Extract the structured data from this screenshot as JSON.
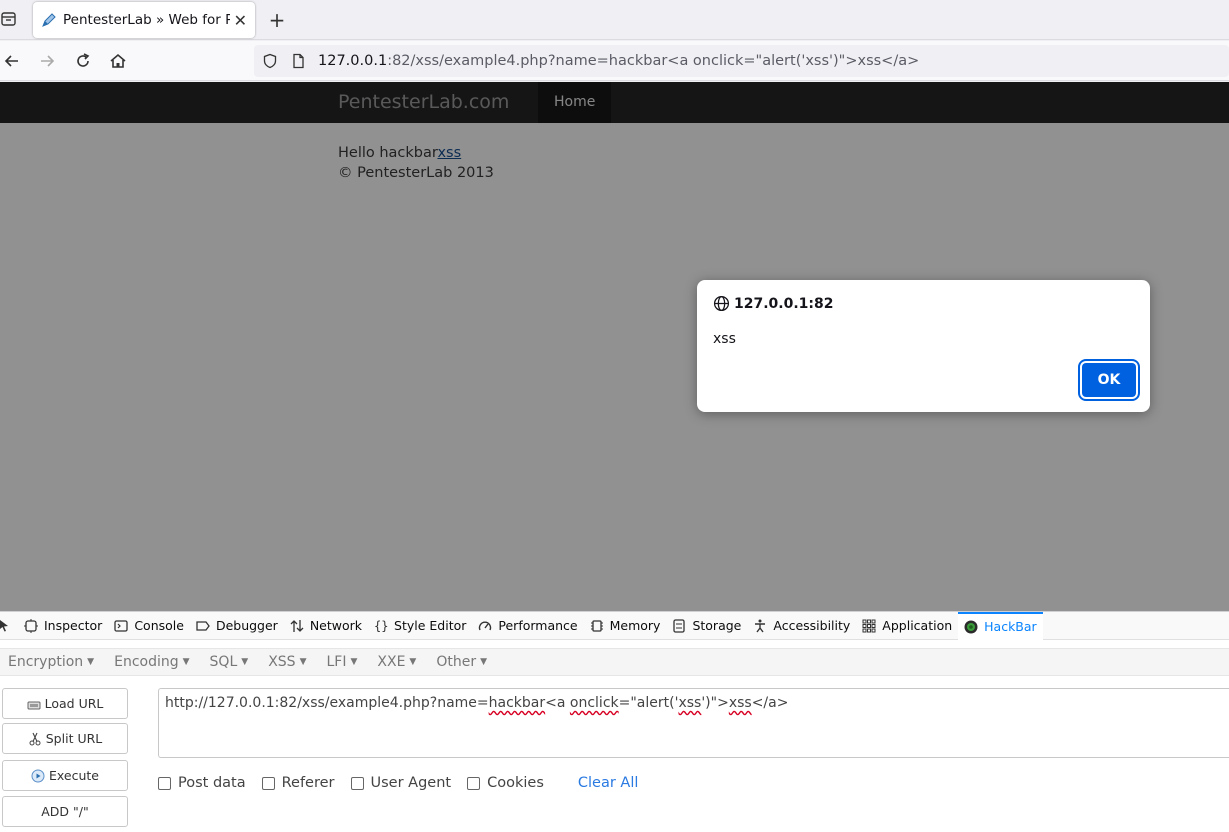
{
  "browser": {
    "tab": {
      "title": "PentesterLab » Web for P"
    },
    "url": {
      "host": "127.0.0.1",
      "rest": ":82/xss/example4.php?name=hackbar<a onclick=\"alert('xss')\">xss</a>"
    }
  },
  "page": {
    "brand": "PentesterLab.com",
    "nav_home": "Home",
    "hello_prefix": "Hello hackbar",
    "hello_link": "xss",
    "footer": "© PentesterLab 2013"
  },
  "dialog": {
    "origin": "127.0.0.1:82",
    "message": "xss",
    "ok_label": "OK"
  },
  "devtools": {
    "tabs": [
      {
        "label": "Inspector",
        "icon": "inspector-icon"
      },
      {
        "label": "Console",
        "icon": "console-icon"
      },
      {
        "label": "Debugger",
        "icon": "debugger-icon"
      },
      {
        "label": "Network",
        "icon": "network-icon"
      },
      {
        "label": "Style Editor",
        "icon": "style-editor-icon"
      },
      {
        "label": "Performance",
        "icon": "performance-icon"
      },
      {
        "label": "Memory",
        "icon": "memory-icon"
      },
      {
        "label": "Storage",
        "icon": "storage-icon"
      },
      {
        "label": "Accessibility",
        "icon": "accessibility-icon"
      },
      {
        "label": "Application",
        "icon": "application-icon"
      },
      {
        "label": "HackBar",
        "icon": "hackbar-icon",
        "selected": true
      }
    ]
  },
  "hackbar": {
    "menu": [
      "Encryption",
      "Encoding",
      "SQL",
      "XSS",
      "LFI",
      "XXE",
      "Other"
    ],
    "buttons": {
      "load_url": "Load URL",
      "split_url": "Split URL",
      "execute": "Execute",
      "add_slash": "ADD \"/\""
    },
    "url": {
      "p1": "http://127.0.0.1:82/xss/example4.php?name=",
      "w1": "hackbar",
      "p2": "<a ",
      "w2": "onclick",
      "p3": "=\"alert('",
      "w3": "xss",
      "p4": "')\">",
      "w4": "xss",
      "p5": "</a>"
    },
    "options": {
      "post_data": "Post data",
      "referer": "Referer",
      "user_agent": "User Agent",
      "cookies": "Cookies",
      "clear_all": "Clear All"
    }
  },
  "colors": {
    "accent": "#0a84ff",
    "dialog_ok": "#0061e0",
    "link": "#2a7ae2"
  }
}
